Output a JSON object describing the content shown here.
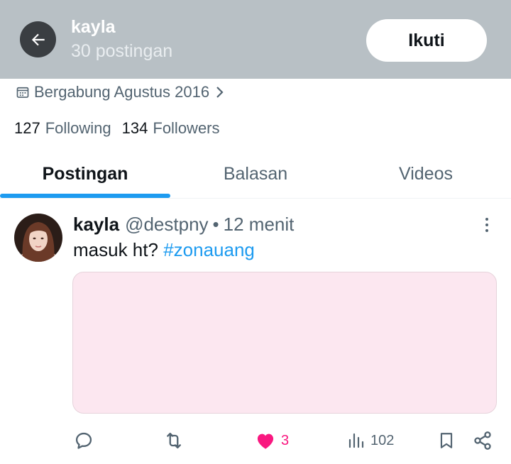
{
  "header": {
    "name": "kayla",
    "post_count": "30 postingan",
    "follow_label": "Ikuti",
    "background": "#b8c0c5"
  },
  "profile": {
    "joined": "Bergabung Agustus 2016",
    "following_count": "127",
    "following_label": "Following",
    "followers_count": "134",
    "followers_label": "Followers"
  },
  "tabs": [
    {
      "label": "Postingan",
      "active": true
    },
    {
      "label": "Balasan",
      "active": false
    },
    {
      "label": "Videos",
      "active": false
    }
  ],
  "post": {
    "author_name": "kayla",
    "author_handle": "@destpny",
    "separator": "•",
    "time": "12 menit",
    "text": "masuk ht?",
    "hashtag": "#zonauang",
    "media_color": "#fce7f0",
    "actions": {
      "reply": {
        "icon": "reply-icon",
        "count": ""
      },
      "repost": {
        "icon": "repost-icon",
        "count": ""
      },
      "like": {
        "icon": "heart-icon",
        "count": "3",
        "liked": true
      },
      "views": {
        "icon": "views-icon",
        "count": "102"
      },
      "bookmark": {
        "icon": "bookmark-icon"
      },
      "share": {
        "icon": "share-icon"
      }
    }
  },
  "colors": {
    "accent": "#1d9bf0",
    "like": "#f91880",
    "muted": "#536471",
    "text": "#0f1419"
  }
}
